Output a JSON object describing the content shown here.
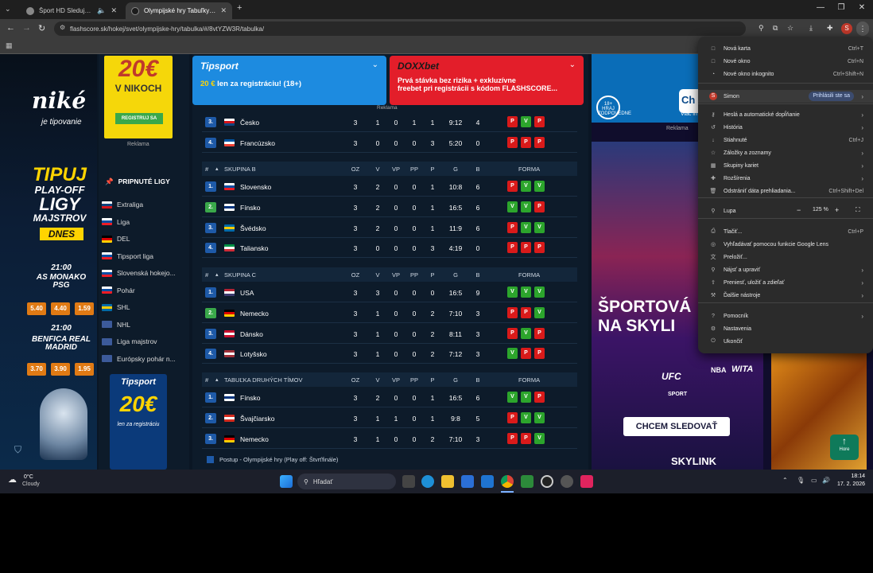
{
  "browser": {
    "tabs": [
      {
        "title": "Šport HD Sledujte na Sweš"
      },
      {
        "title": "Olympijské hry Tabuľky - Hokej"
      }
    ],
    "url": "flashscore.sk/hokej/svet/olympijske-hry/tabulka/#/8vtYZW3R/tabulka/",
    "profile_initial": "S"
  },
  "ads": {
    "top_left": "20€",
    "top_left_sub": "V NIKOCH",
    "top_left_btn": "REGISTRUJ SA",
    "reklama": "Reklama",
    "nike": "niké",
    "nike_sub": "je tipovanie",
    "tipuj": "TIPUJ",
    "playoff": "PLAY-OFF",
    "ligy": "LIGY",
    "majstrov": "MAJSTROV",
    "dnes": "DNES",
    "m1_time": "21:00",
    "m1_teams": "AS MONAKO PSG",
    "m1_odds": [
      "5.40",
      "4.40",
      "1.59"
    ],
    "m2_time": "21:00",
    "m2_teams": "BENFICA REAL MADRID",
    "m2_odds": [
      "3.70",
      "3.90",
      "1.95"
    ],
    "tipsport_small": "Tipsport",
    "tipsport_amount": "20€",
    "tipsport_small_sub": "len za registráciu",
    "banner1_brand": "Tipsport",
    "banner1_text": "20 € len za registráciu! (18+)",
    "banner1_amount": "20 €",
    "banner1_rest": "len za registráciu! (18+)",
    "banner2_brand": "DOXXbet",
    "banner2_line1": "Prvá stávka bez rizika + exkluzívne",
    "banner2_line2": "freebet pri registrácii s kódom FLASHSCORE...",
    "right_top_age": "18+ HRAJ ZODPOVEDNE",
    "right_top_ch": "Ch",
    "right_top_sub": "Viac in",
    "sportova": "ŠPORTOVÁ",
    "na_skyli": "NA SKYLI",
    "channels": [
      "UFC",
      "NBA",
      "WITA",
      "SPORT"
    ],
    "chcem": "CHCEM SLEDOVAŤ",
    "skylink": "SKYLINK",
    "hore": "Hore"
  },
  "sidebar": {
    "title": "PRIPNUTÉ LIGY",
    "items": [
      {
        "label": "Extraliga",
        "colors": [
          "#ffffff",
          "#11457e",
          "#d7141a"
        ]
      },
      {
        "label": "Liga",
        "colors": [
          "#ffffff",
          "#0b4ea2",
          "#ee1c25"
        ]
      },
      {
        "label": "DEL",
        "colors": [
          "#000000",
          "#dd0000",
          "#ffce00"
        ]
      },
      {
        "label": "Tipsport liga",
        "colors": [
          "#ffffff",
          "#0b4ea2",
          "#ee1c25"
        ]
      },
      {
        "label": "Slovenská hokejo...",
        "colors": [
          "#ffffff",
          "#0b4ea2",
          "#ee1c25"
        ]
      },
      {
        "label": "Pohár",
        "colors": [
          "#ffffff",
          "#0b4ea2",
          "#ee1c25"
        ]
      },
      {
        "label": "SHL",
        "colors": [
          "#006aa7",
          "#fecc00",
          "#006aa7"
        ]
      },
      {
        "label": "NHL",
        "colors": [
          "#3c5a9a",
          "#3c5a9a",
          "#3c5a9a"
        ]
      },
      {
        "label": "Liga majstrov",
        "colors": [
          "#3c5a9a",
          "#3c5a9a",
          "#3c5a9a"
        ]
      },
      {
        "label": "Európsky pohár n...",
        "colors": [
          "#3c5a9a",
          "#3c5a9a",
          "#3c5a9a"
        ]
      }
    ]
  },
  "table": {
    "headers": {
      "hash": "#",
      "oz": "OZ",
      "v": "V",
      "vp": "VP",
      "pp": "PP",
      "p": "P",
      "g": "G",
      "b": "B",
      "forma": "FORMA"
    },
    "groupA_rows": [
      {
        "rank": "3.",
        "team": "Česko",
        "oz": "3",
        "v": "1",
        "vp": "0",
        "pp": "1",
        "p": "1",
        "g": "9:12",
        "b": "4",
        "form": [
          "P",
          "V",
          "P"
        ],
        "flag": [
          "#ffffff",
          "#d7141a",
          "#11457e"
        ],
        "rankColor": "#1e5aa8"
      },
      {
        "rank": "4.",
        "team": "Francúzsko",
        "oz": "3",
        "v": "0",
        "vp": "0",
        "pp": "0",
        "p": "3",
        "g": "5:20",
        "b": "0",
        "form": [
          "P",
          "P",
          "P"
        ],
        "flag": [
          "#0055a4",
          "#ffffff",
          "#ef4135"
        ],
        "rankColor": "#1e5aa8"
      }
    ],
    "groups": [
      {
        "name": "SKUPINA B",
        "rows": [
          {
            "rank": "1.",
            "team": "Slovensko",
            "oz": "3",
            "v": "2",
            "vp": "0",
            "pp": "0",
            "p": "1",
            "g": "10:8",
            "b": "6",
            "form": [
              "P",
              "V",
              "V"
            ],
            "flag": [
              "#ffffff",
              "#0b4ea2",
              "#ee1c25"
            ],
            "rankColor": "#1e5aa8"
          },
          {
            "rank": "2.",
            "team": "Fínsko",
            "oz": "3",
            "v": "2",
            "vp": "0",
            "pp": "0",
            "p": "1",
            "g": "16:5",
            "b": "6",
            "form": [
              "V",
              "V",
              "P"
            ],
            "flag": [
              "#ffffff",
              "#003580",
              "#ffffff"
            ],
            "rankColor": "#3aa84a"
          },
          {
            "rank": "3.",
            "team": "Švédsko",
            "oz": "3",
            "v": "2",
            "vp": "0",
            "pp": "0",
            "p": "1",
            "g": "11:9",
            "b": "6",
            "form": [
              "P",
              "V",
              "V"
            ],
            "flag": [
              "#006aa7",
              "#fecc00",
              "#006aa7"
            ],
            "rankColor": "#1e5aa8"
          },
          {
            "rank": "4.",
            "team": "Taliansko",
            "oz": "3",
            "v": "0",
            "vp": "0",
            "pp": "0",
            "p": "3",
            "g": "4:19",
            "b": "0",
            "form": [
              "P",
              "P",
              "P"
            ],
            "flag": [
              "#009246",
              "#ffffff",
              "#ce2b37"
            ],
            "rankColor": "#1e5aa8"
          }
        ]
      },
      {
        "name": "SKUPINA C",
        "rows": [
          {
            "rank": "1.",
            "team": "USA",
            "oz": "3",
            "v": "3",
            "vp": "0",
            "pp": "0",
            "p": "0",
            "g": "16:5",
            "b": "9",
            "form": [
              "V",
              "V",
              "V"
            ],
            "flag": [
              "#b22234",
              "#ffffff",
              "#3c3b6e"
            ],
            "rankColor": "#1e5aa8"
          },
          {
            "rank": "2.",
            "team": "Nemecko",
            "oz": "3",
            "v": "1",
            "vp": "0",
            "pp": "0",
            "p": "2",
            "g": "7:10",
            "b": "3",
            "form": [
              "P",
              "P",
              "V"
            ],
            "flag": [
              "#000000",
              "#dd0000",
              "#ffce00"
            ],
            "rankColor": "#3aa84a"
          },
          {
            "rank": "3.",
            "team": "Dánsko",
            "oz": "3",
            "v": "1",
            "vp": "0",
            "pp": "0",
            "p": "2",
            "g": "8:11",
            "b": "3",
            "form": [
              "P",
              "V",
              "P"
            ],
            "flag": [
              "#c8102e",
              "#ffffff",
              "#c8102e"
            ],
            "rankColor": "#1e5aa8"
          },
          {
            "rank": "4.",
            "team": "Lotyšsko",
            "oz": "3",
            "v": "1",
            "vp": "0",
            "pp": "0",
            "p": "2",
            "g": "7:12",
            "b": "3",
            "form": [
              "V",
              "P",
              "P"
            ],
            "flag": [
              "#9e3039",
              "#ffffff",
              "#9e3039"
            ],
            "rankColor": "#1e5aa8"
          }
        ]
      },
      {
        "name": "TABUĽKA DRUHÝCH TÍMOV",
        "rows": [
          {
            "rank": "1.",
            "team": "Fínsko",
            "oz": "3",
            "v": "2",
            "vp": "0",
            "pp": "0",
            "p": "1",
            "g": "16:5",
            "b": "6",
            "form": [
              "V",
              "V",
              "P"
            ],
            "flag": [
              "#ffffff",
              "#003580",
              "#ffffff"
            ],
            "rankColor": "#1e5aa8"
          },
          {
            "rank": "2.",
            "team": "Švajčiarsko",
            "oz": "3",
            "v": "1",
            "vp": "1",
            "pp": "0",
            "p": "1",
            "g": "9:8",
            "b": "5",
            "form": [
              "P",
              "V",
              "V"
            ],
            "flag": [
              "#d52b1e",
              "#ffffff",
              "#d52b1e"
            ],
            "rankColor": "#1e5aa8"
          },
          {
            "rank": "3.",
            "team": "Nemecko",
            "oz": "3",
            "v": "1",
            "vp": "0",
            "pp": "0",
            "p": "2",
            "g": "7:10",
            "b": "3",
            "form": [
              "P",
              "P",
              "V"
            ],
            "flag": [
              "#000000",
              "#dd0000",
              "#ffce00"
            ],
            "rankColor": "#1e5aa8"
          }
        ]
      }
    ],
    "legend": "Postup - Olympijské hry (Play off: Štvrťfinále)"
  },
  "menu": {
    "items": [
      {
        "label": "Nová karta",
        "shortcut": "Ctrl+T",
        "icon": "□"
      },
      {
        "label": "Nové okno",
        "shortcut": "Ctrl+N",
        "icon": "□"
      },
      {
        "label": "Nové okno inkognito",
        "shortcut": "Ctrl+Shift+N",
        "icon": "◔"
      },
      {
        "label": "Simon",
        "badge": "Prihlásili ste sa",
        "icon": "S"
      },
      {
        "label": "Heslá a automatické dopĺňanie",
        "icon": "⚷"
      },
      {
        "label": "História",
        "icon": "↺"
      },
      {
        "label": "Stiahnuté",
        "shortcut": "Ctrl+J",
        "icon": "↓"
      },
      {
        "label": "Záložky a zoznamy",
        "icon": "☆"
      },
      {
        "label": "Skupiny kariet",
        "icon": "▦"
      },
      {
        "label": "Rozšírenia",
        "icon": "✚"
      },
      {
        "label": "Odstrániť dáta prehliadania...",
        "shortcut": "Ctrl+Shift+Del",
        "icon": "🗑"
      },
      {
        "label": "Lupa",
        "zoom": "125 %",
        "icon": "⚲"
      },
      {
        "label": "Tlačiť...",
        "shortcut": "Ctrl+P",
        "icon": "⎙"
      },
      {
        "label": "Vyhľadávať pomocou funkcie Google Lens",
        "icon": "◎"
      },
      {
        "label": "Preložiť...",
        "icon": "文"
      },
      {
        "label": "Nájsť a upraviť",
        "icon": "⚲"
      },
      {
        "label": "Preniesť, uložiť a zdieľať",
        "icon": "⇪"
      },
      {
        "label": "Ďalšie nástroje",
        "icon": "⚒"
      },
      {
        "label": "Pomocník",
        "icon": "?"
      },
      {
        "label": "Nastavenia",
        "icon": "⚙"
      },
      {
        "label": "Ukončiť",
        "icon": "⏻"
      }
    ]
  },
  "taskbar": {
    "temp": "0°C",
    "weather": "Cloudy",
    "search": "Hľadať",
    "time": "18:14",
    "date": "17. 2. 2026"
  }
}
